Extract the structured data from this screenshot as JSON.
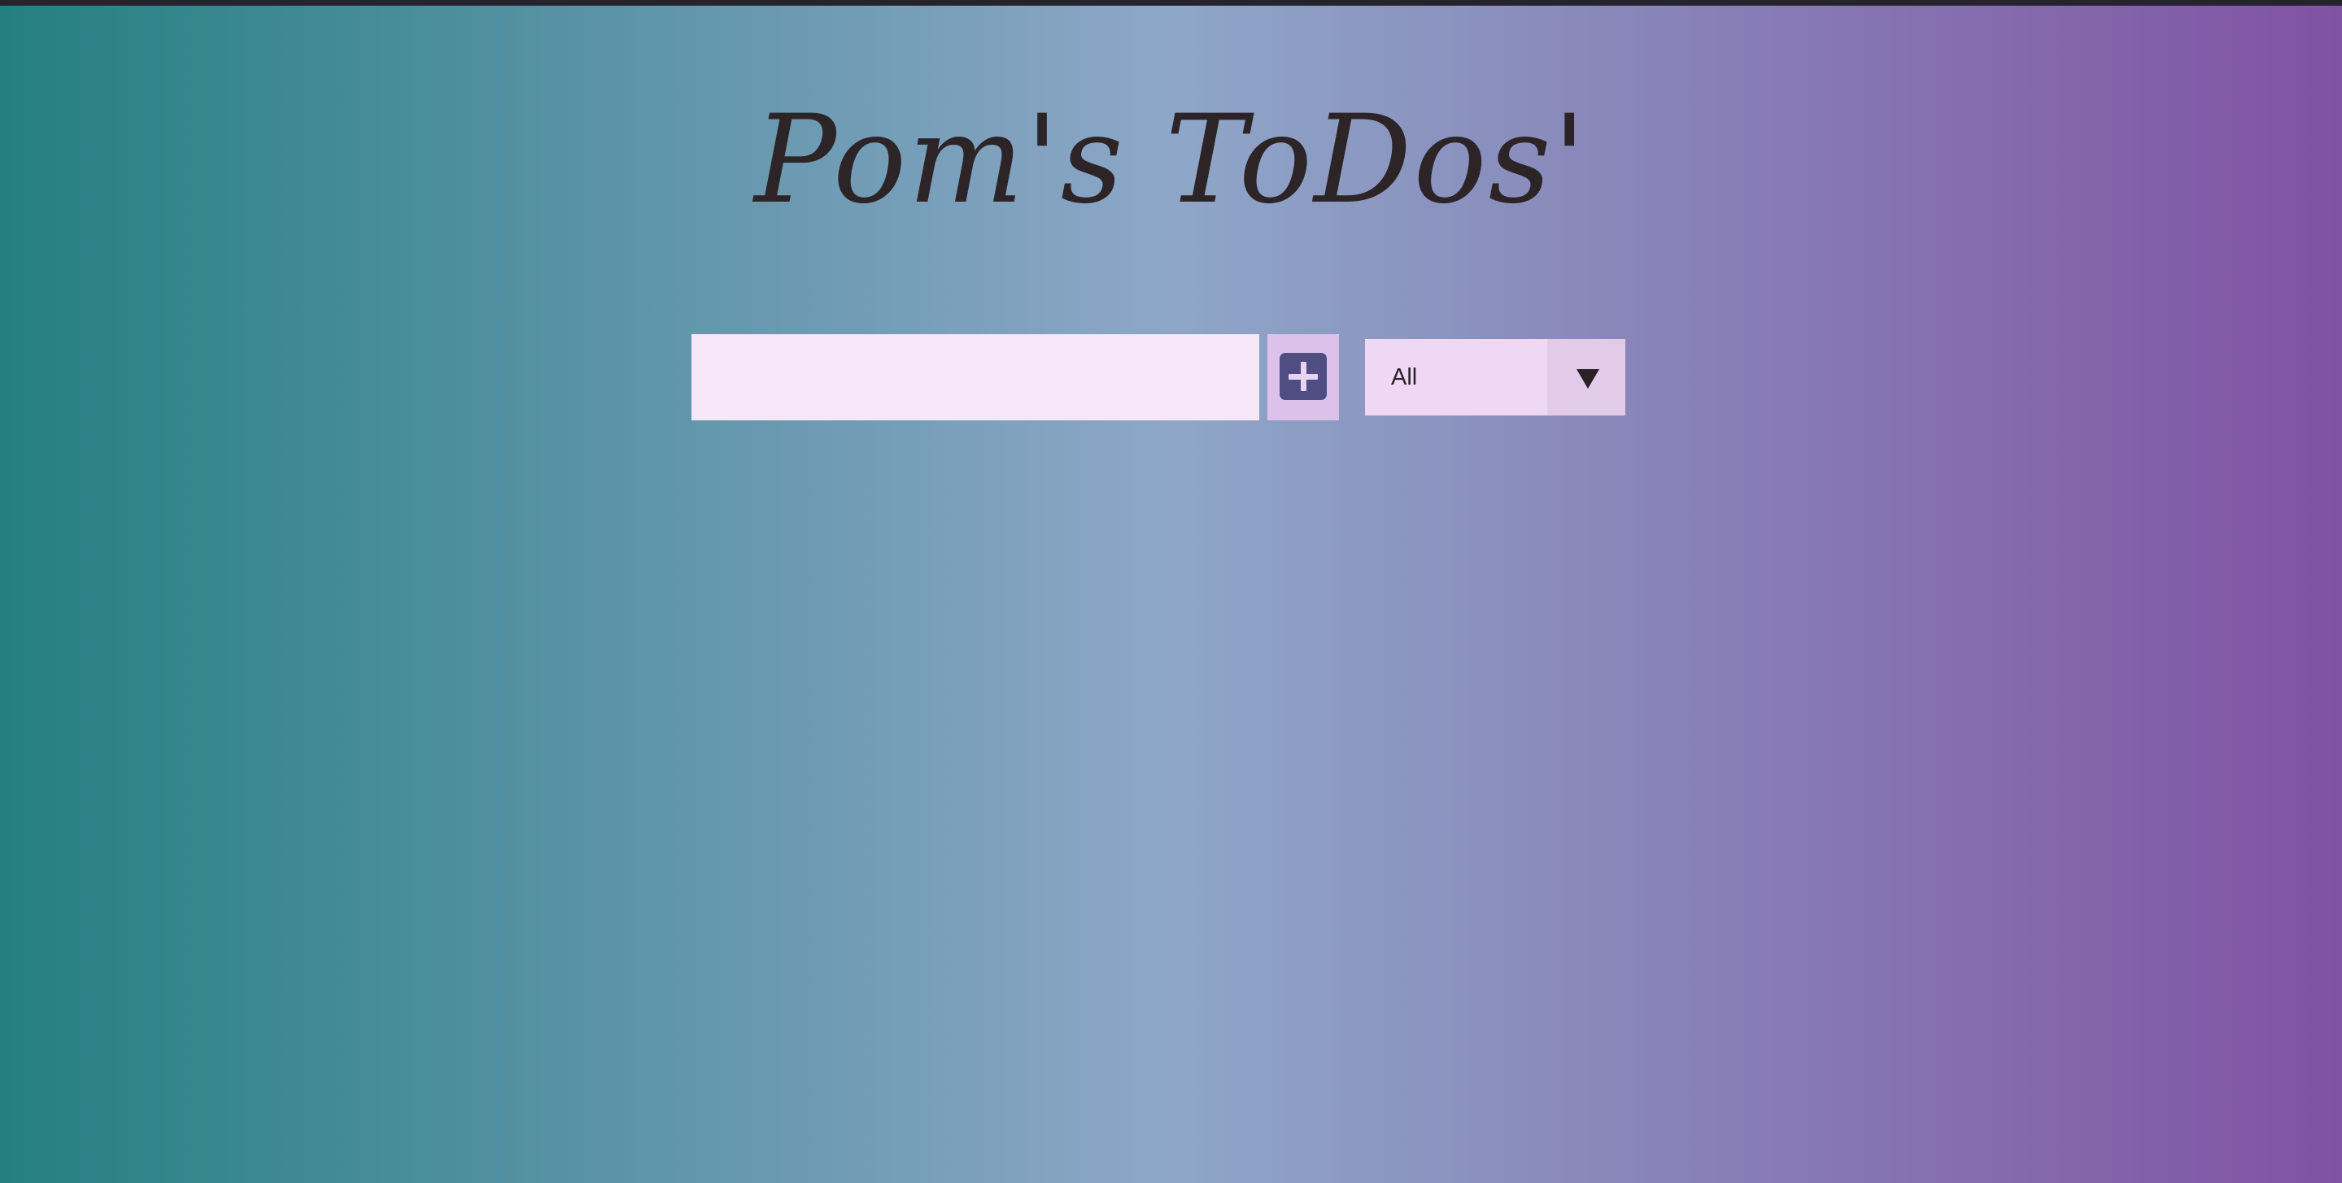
{
  "app": {
    "title": "Pom's ToDos'"
  },
  "todo_form": {
    "input_value": "",
    "add_button_icon": "plus-square-icon",
    "filter": {
      "selected": "All",
      "arrow_icon": "caret-down-icon"
    }
  },
  "colors": {
    "background_gradient": [
      "#247f82",
      "#8ea7c8",
      "#8052a3"
    ],
    "input_background": "#f5e6f8",
    "button_background": "#dcc2eb",
    "icon_color": "#4f4d81",
    "filter_background": "#efd8f3",
    "filter_arrow_background": "#e1cbe8",
    "text_color": "#2d2427"
  }
}
